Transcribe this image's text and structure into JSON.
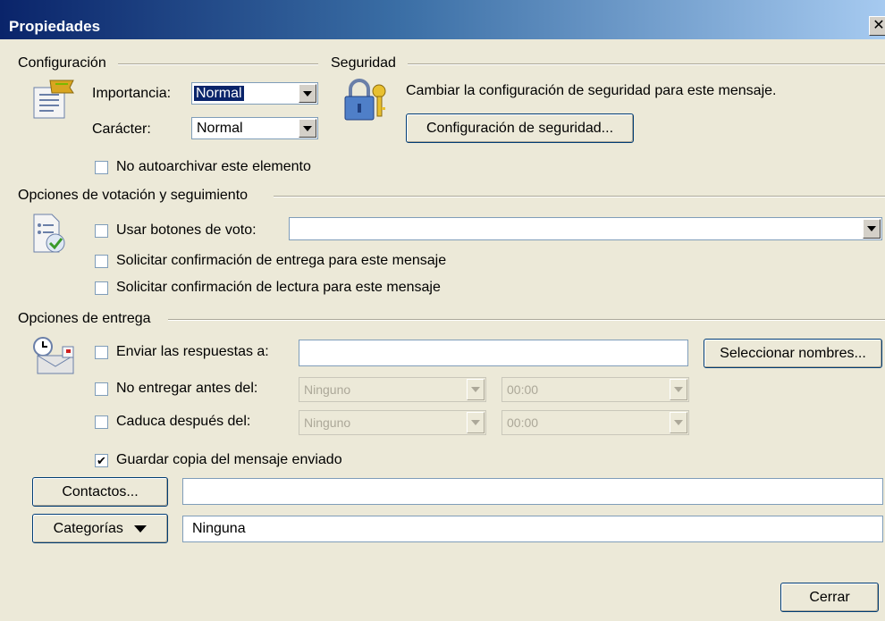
{
  "window": {
    "title": "Propiedades",
    "close_glyph": "✕"
  },
  "configuracion": {
    "heading": "Configuración",
    "importancia_label": "Importancia:",
    "importancia_value": "Normal",
    "caracter_label": "Carácter:",
    "caracter_value": "Normal",
    "no_autoarchivar_label": "No autoarchivar este elemento",
    "no_autoarchivar_checked": false
  },
  "seguridad": {
    "heading": "Seguridad",
    "description": "Cambiar la configuración de seguridad para este mensaje.",
    "button_label": "Configuración de seguridad..."
  },
  "votacion": {
    "heading": "Opciones de votación y seguimiento",
    "usar_botones_label": "Usar botones de voto:",
    "usar_botones_value": "",
    "solicitar_entrega_label": "Solicitar confirmación de entrega para este mensaje",
    "solicitar_lectura_label": "Solicitar confirmación de lectura para este mensaje"
  },
  "entrega": {
    "heading": "Opciones de entrega",
    "enviar_respuestas_label": "Enviar las respuestas a:",
    "enviar_respuestas_value": "",
    "seleccionar_nombres_label": "Seleccionar nombres...",
    "no_entregar_label": "No entregar antes del:",
    "no_entregar_date": "Ninguno",
    "no_entregar_time": "00:00",
    "caduca_label": "Caduca después del:",
    "caduca_date": "Ninguno",
    "caduca_time": "00:00",
    "guardar_copia_label": "Guardar copia del mensaje enviado",
    "guardar_copia_checked": true
  },
  "contactos": {
    "button_label": "Contactos...",
    "value": ""
  },
  "categorias": {
    "button_label": "Categorías",
    "value": "Ninguna"
  },
  "footer": {
    "cerrar_label": "Cerrar"
  },
  "icons": [
    "flag-doc-icon",
    "lock-key-icon",
    "vote-doc-icon",
    "clock-envelope-icon",
    "dropdown-arrow-icon"
  ]
}
